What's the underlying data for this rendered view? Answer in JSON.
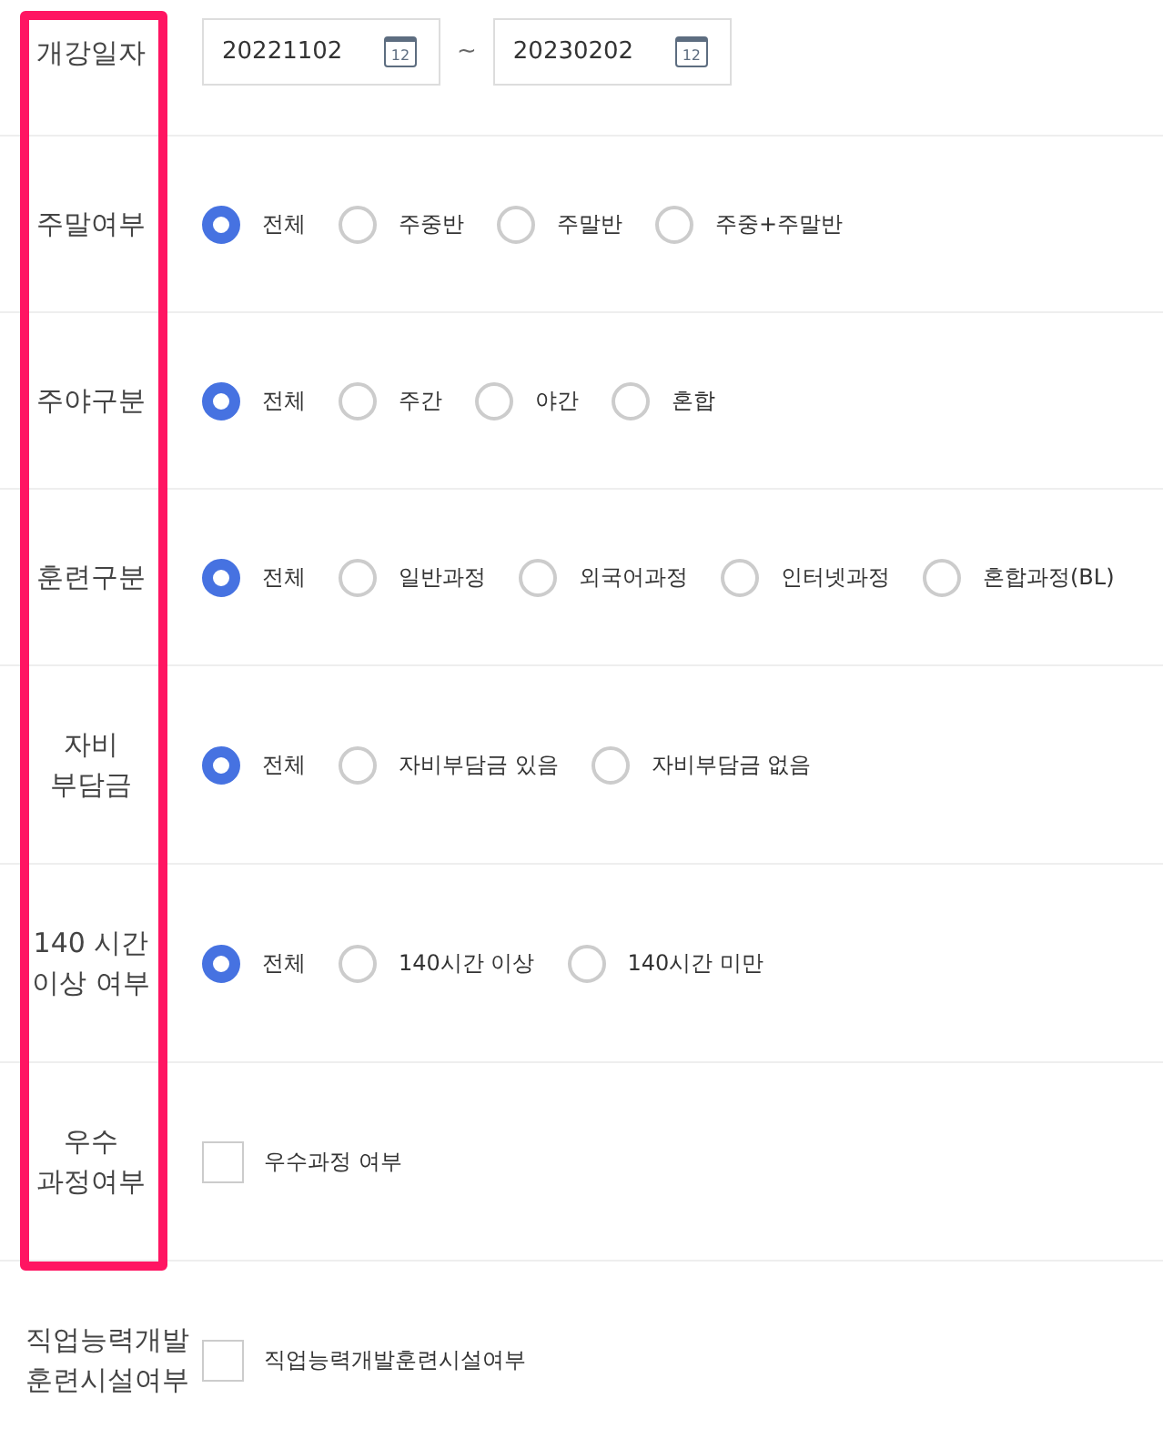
{
  "filters": [
    {
      "kind": "date_range",
      "label": "개강일자",
      "start": {
        "value": "20221102",
        "icon_text": "12"
      },
      "separator": "~",
      "end": {
        "value": "20230202",
        "icon_text": "12"
      }
    },
    {
      "kind": "radio",
      "label": "주말여부",
      "options": [
        {
          "label": "전체",
          "selected": true
        },
        {
          "label": "주중반",
          "selected": false
        },
        {
          "label": "주말반",
          "selected": false
        },
        {
          "label": "주중+주말반",
          "selected": false
        }
      ]
    },
    {
      "kind": "radio",
      "label": "주야구분",
      "options": [
        {
          "label": "전체",
          "selected": true
        },
        {
          "label": "주간",
          "selected": false
        },
        {
          "label": "야간",
          "selected": false
        },
        {
          "label": "혼합",
          "selected": false
        }
      ]
    },
    {
      "kind": "radio",
      "label": "훈련구분",
      "options": [
        {
          "label": "전체",
          "selected": true
        },
        {
          "label": "일반과정",
          "selected": false
        },
        {
          "label": "외국어과정",
          "selected": false
        },
        {
          "label": "인터넷과정",
          "selected": false
        },
        {
          "label": "혼합과정(BL)",
          "selected": false
        }
      ]
    },
    {
      "kind": "radio",
      "label": "자비\n부담금",
      "options": [
        {
          "label": "전체",
          "selected": true
        },
        {
          "label": "자비부담금 있음",
          "selected": false
        },
        {
          "label": "자비부담금 없음",
          "selected": false
        }
      ]
    },
    {
      "kind": "radio",
      "label": "140 시간\n이상 여부",
      "options": [
        {
          "label": "전체",
          "selected": true
        },
        {
          "label": "140시간 이상",
          "selected": false
        },
        {
          "label": "140시간 미만",
          "selected": false
        }
      ]
    },
    {
      "kind": "checkbox",
      "label": "우수\n과정여부",
      "option": {
        "label": "우수과정 여부",
        "checked": false
      }
    },
    {
      "kind": "checkbox",
      "label": "직업능력개발\n훈련시설여부",
      "option": {
        "label": "직업능력개발훈련시설여부",
        "checked": false
      }
    }
  ]
}
